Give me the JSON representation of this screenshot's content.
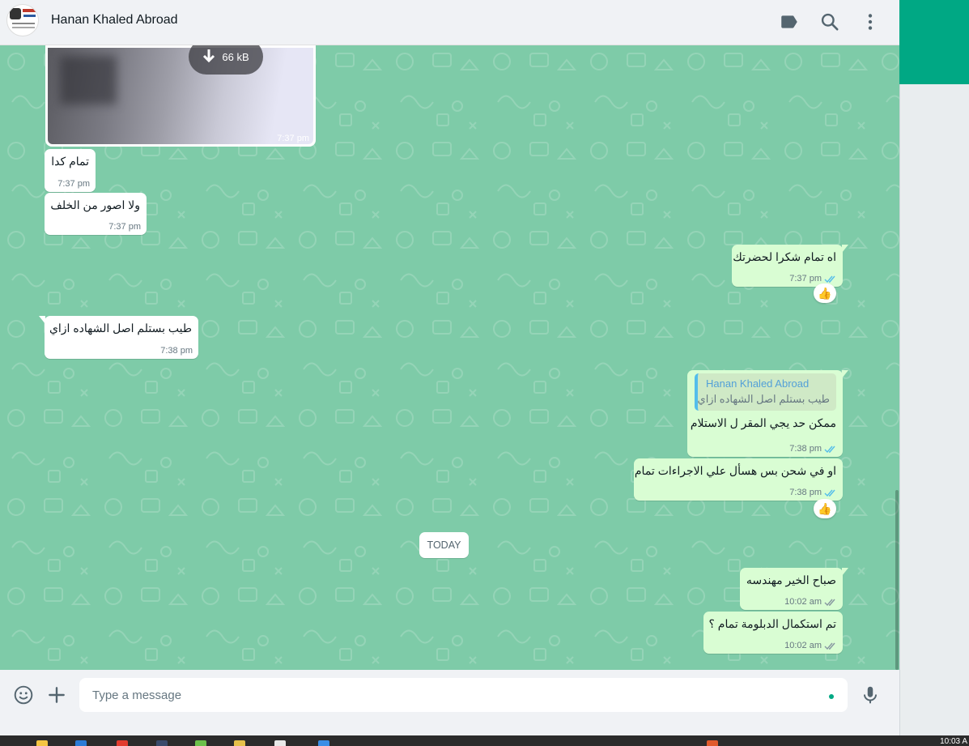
{
  "header": {
    "contact_name": "Hanan Khaled Abroad",
    "icons": [
      "label-icon",
      "search-icon",
      "menu-kebab-icon"
    ]
  },
  "messages": {
    "image": {
      "size": "66 kB",
      "time": "7:37 pm"
    },
    "m1": {
      "text": "تمام كدا",
      "time": "7:37 pm"
    },
    "m2": {
      "text": "ولا اصور من الخلف",
      "time": "7:37 pm"
    },
    "m3": {
      "text": "اه تمام شكرا لحضرتك",
      "time": "7:37 pm",
      "reaction": "👍"
    },
    "m4": {
      "text": "طيب بستلم اصل الشهاده ازاي",
      "time": "7:38 pm"
    },
    "m5": {
      "quote_author": "Hanan Khaled Abroad",
      "quote_text": "طيب بستلم اصل الشهاده ازاي",
      "text": "ممكن حد يجي المقر ل الاستلام",
      "time": "7:38 pm"
    },
    "m6": {
      "text": "او في شحن بس هسأل علي الاجراءات تمام",
      "time": "7:38 pm",
      "reaction": "👍"
    },
    "date_divider": "TODAY",
    "m7": {
      "text": "صباح الخير مهندسه",
      "time": "10:02 am"
    },
    "m8": {
      "text": "تم استكمال الدبلومة تمام ؟",
      "time": "10:02 am"
    }
  },
  "composer": {
    "placeholder": "Type a message"
  },
  "taskbar": {
    "clock": "10:03 A"
  },
  "colors": {
    "chat_bg": "#7ecba8",
    "outgoing": "#d9fdd3",
    "incoming": "#ffffff",
    "accent": "#00a884",
    "read_ticks": "#53bdeb"
  }
}
